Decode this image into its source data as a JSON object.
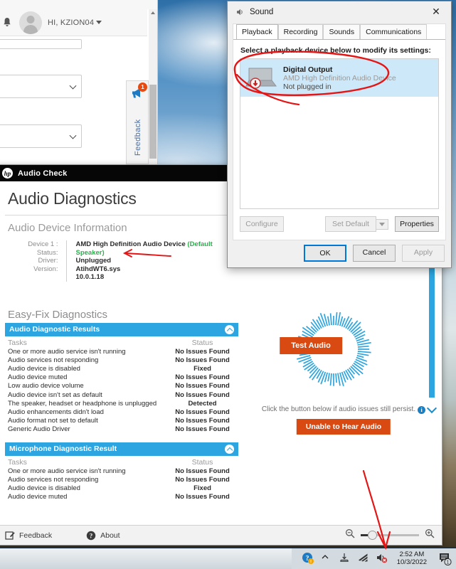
{
  "browser": {
    "user_greeting": "HI, KZION04",
    "bell_icon": "notification-bell-icon",
    "feedback_tab_label": "Feedback",
    "feedback_badge": "1"
  },
  "hp_app": {
    "title": "Audio Check",
    "logo_text": "hp",
    "page_title": "Audio Diagnostics",
    "device_info_heading": "Audio Device Information",
    "device": {
      "labels": [
        "Device 1 :",
        "Status:",
        "Driver:",
        "Version:"
      ],
      "name": "AMD High Definition Audio Device",
      "default_tag": "(Default Speaker)",
      "status": "Unplugged",
      "driver": "AtihdWT6.sys",
      "version": "10.0.1.18"
    },
    "easyfix_heading": "Easy-Fix Diagnostics",
    "sections": [
      {
        "title": "Audio Diagnostic Results",
        "col_tasks": "Tasks",
        "col_status": "Status",
        "rows": [
          {
            "task": "One or more audio service isn't running",
            "status": "No Issues Found",
            "state": "ok"
          },
          {
            "task": "Audio services not responding",
            "status": "No Issues Found",
            "state": "ok"
          },
          {
            "task": "Audio device is disabled",
            "status": "Fixed",
            "state": "fixed"
          },
          {
            "task": "Audio device muted",
            "status": "No Issues Found",
            "state": "ok"
          },
          {
            "task": "Low audio device volume",
            "status": "No Issues Found",
            "state": "ok"
          },
          {
            "task": "Audio device isn't set as default",
            "status": "No Issues Found",
            "state": "ok"
          },
          {
            "task": "The speaker, headset or headphone is unplugged",
            "status": "Detected",
            "state": "detected"
          },
          {
            "task": "Audio enhancements didn't load",
            "status": "No Issues Found",
            "state": "ok"
          },
          {
            "task": "Audio format not set to default",
            "status": "No Issues Found",
            "state": "ok"
          },
          {
            "task": "Generic Audio Driver",
            "status": "No Issues Found",
            "state": "ok"
          }
        ]
      },
      {
        "title": "Microphone Diagnostic Result",
        "col_tasks": "Tasks",
        "col_status": "Status",
        "rows": [
          {
            "task": "One or more audio service isn't running",
            "status": "No Issues Found",
            "state": "ok"
          },
          {
            "task": "Audio services not responding",
            "status": "No Issues Found",
            "state": "ok"
          },
          {
            "task": "Audio device is disabled",
            "status": "Fixed",
            "state": "fixed"
          },
          {
            "task": "Audio device muted",
            "status": "No Issues Found",
            "state": "ok"
          }
        ]
      }
    ],
    "test_audio_label": "Test Audio",
    "persist_text": "Click the button below if audio issues still persist.",
    "info_glyph": "i",
    "unable_label": "Unable to Hear Audio",
    "footer": {
      "feedback": "Feedback",
      "about": "About",
      "zoom_out_icon": "zoom-out-icon",
      "zoom_in_icon": "zoom-in-icon"
    }
  },
  "sound_dialog": {
    "title": "Sound",
    "close_glyph": "✕",
    "tabs": [
      {
        "label": "Playback",
        "active": true
      },
      {
        "label": "Recording",
        "active": false
      },
      {
        "label": "Sounds",
        "active": false
      },
      {
        "label": "Communications",
        "active": false
      }
    ],
    "prompt": "Select a playback device below to modify its settings:",
    "device": {
      "name": "Digital Output",
      "driver": "AMD High Definition Audio Device",
      "state": "Not plugged in"
    },
    "buttons": {
      "configure": "Configure",
      "set_default": "Set Default",
      "properties": "Properties",
      "ok": "OK",
      "cancel": "Cancel",
      "apply": "Apply"
    }
  },
  "taskbar": {
    "time": "2:52 AM",
    "date": "10/3/2022",
    "tray_icons": [
      "help-support-icon",
      "show-hidden-icons-chevron",
      "onedrive-icon",
      "wifi-icon",
      "volume-muted-icon"
    ],
    "notification_count": "1"
  },
  "colors": {
    "accent_blue": "#2ca5e0",
    "orange_button": "#d94a12",
    "status_ok": "#2ca5e0",
    "status_fixed": "#17a01e",
    "status_detected": "#f2a100",
    "default_speaker_green": "#2fae4e",
    "annotation_red": "#e31515"
  }
}
